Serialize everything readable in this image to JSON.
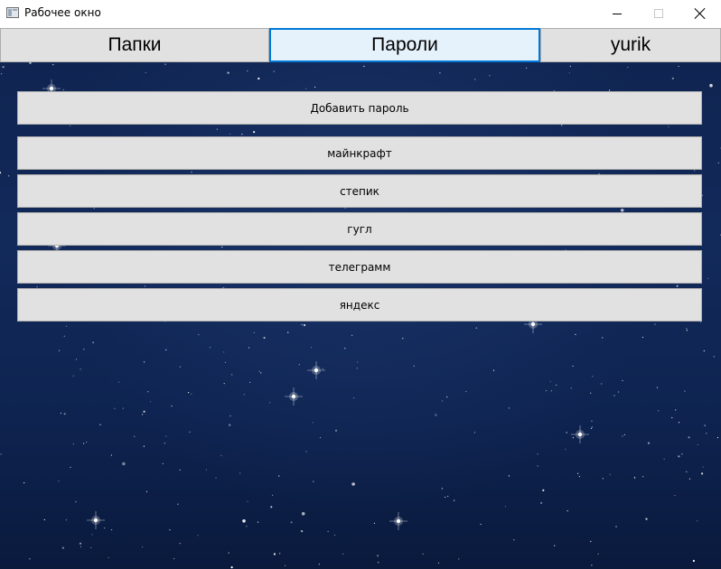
{
  "window": {
    "title": "Рабочее окно",
    "icon": "app-window-icon",
    "controls": [
      "minimize-icon",
      "maximize-icon",
      "close-icon"
    ]
  },
  "tabs": [
    {
      "label": "Папки",
      "selected": false
    },
    {
      "label": "Пароли",
      "selected": true
    },
    {
      "label": "yurik",
      "selected": false
    }
  ],
  "main": {
    "add_button": "Добавить пароль",
    "passwords": [
      "майнкрафт",
      "степик",
      "гугл",
      "телеграмм",
      "яндекс"
    ]
  },
  "colors": {
    "tab_selected_bg": "#e5f1fb",
    "tab_selected_border": "#0078d7",
    "button_bg": "#e1e1e1",
    "background": "#122a5a"
  }
}
